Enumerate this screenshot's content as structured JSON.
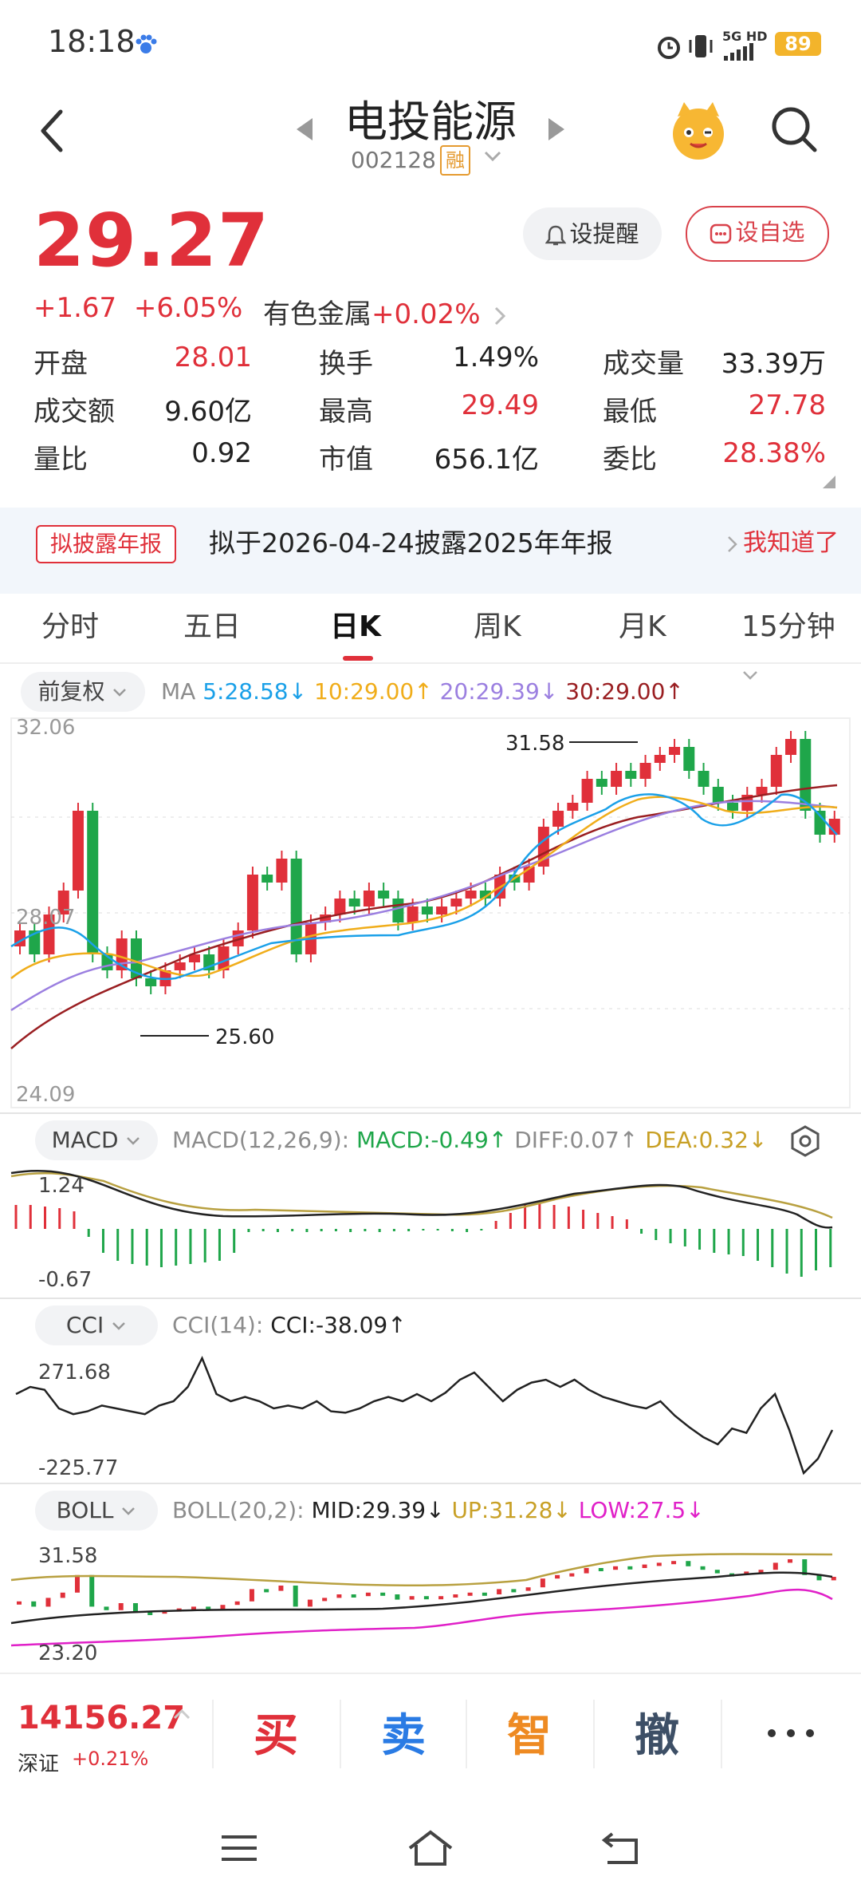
{
  "status_bar": {
    "time": "18:18",
    "network": "5G HD",
    "battery": "89"
  },
  "header": {
    "title": "电投能源",
    "code": "002128",
    "margin_badge": "融"
  },
  "quote": {
    "price": "29.27",
    "change": "+1.67",
    "change_pct": "+6.05%",
    "sector": "有色金属",
    "sector_change": "+0.02%",
    "remind_label": "设提醒",
    "watchlist_label": "设自选"
  },
  "stats": [
    {
      "label": "开盘",
      "value": "28.01",
      "color": "#e0303a"
    },
    {
      "label": "换手",
      "value": "1.49%",
      "color": "#222222"
    },
    {
      "label": "成交量",
      "value": "33.39万",
      "color": "#222222"
    },
    {
      "label": "成交额",
      "value": "9.60亿",
      "color": "#222222"
    },
    {
      "label": "最高",
      "value": "29.49",
      "color": "#e0303a"
    },
    {
      "label": "最低",
      "value": "27.78",
      "color": "#e0303a"
    },
    {
      "label": "量比",
      "value": "0.92",
      "color": "#222222"
    },
    {
      "label": "市值",
      "value": "656.1亿",
      "color": "#222222"
    },
    {
      "label": "委比",
      "value": "28.38%",
      "color": "#e0303a"
    }
  ],
  "notice": {
    "badge": "拟披露年报",
    "text": "拟于2026-04-24披露2025年年报",
    "action": "我知道了"
  },
  "tabs": [
    "分时",
    "五日",
    "日K",
    "周K",
    "月K",
    "15分钟"
  ],
  "active_tab": "日K",
  "kline": {
    "adjust_label": "前复权",
    "ma_label": "MA",
    "ma5": "5:28.58↓",
    "ma10": "10:29.00↑",
    "ma20": "20:29.39↓",
    "ma30": "30:29.00↑",
    "y_max": "32.06",
    "y_mid": "28.07",
    "y_min": "24.09",
    "high_mark": "31.58",
    "low_mark": "25.60"
  },
  "macd": {
    "label": "MACD",
    "params": "MACD(12,26,9):",
    "macd": "MACD:-0.49↑",
    "diff": "DIFF:0.07↑",
    "dea": "DEA:0.32↓",
    "y_top": "1.24",
    "y_bottom": "-0.67"
  },
  "cci": {
    "label": "CCI",
    "params": "CCI(14):",
    "cci": "CCI:-38.09↑",
    "y_top": "271.68",
    "y_bottom": "-225.77"
  },
  "boll": {
    "label": "BOLL",
    "params": "BOLL(20,2):",
    "mid": "MID:29.39↓",
    "up": "UP:31.28↓",
    "low": "LOW:27.5↓",
    "y_top": "31.58",
    "y_bottom": "23.20"
  },
  "bottom": {
    "index_value": "14156.27",
    "index_name": "深证",
    "index_change": "+0.21%",
    "buy": "买",
    "sell": "卖",
    "smart": "智",
    "cancel": "撤"
  },
  "colors": {
    "up": "#e0303a",
    "down": "#1fa64a",
    "ma5": "#1aa0e8",
    "ma10": "#f0ad1a",
    "ma20": "#9b7fe0",
    "ma30": "#9a1f22"
  }
}
